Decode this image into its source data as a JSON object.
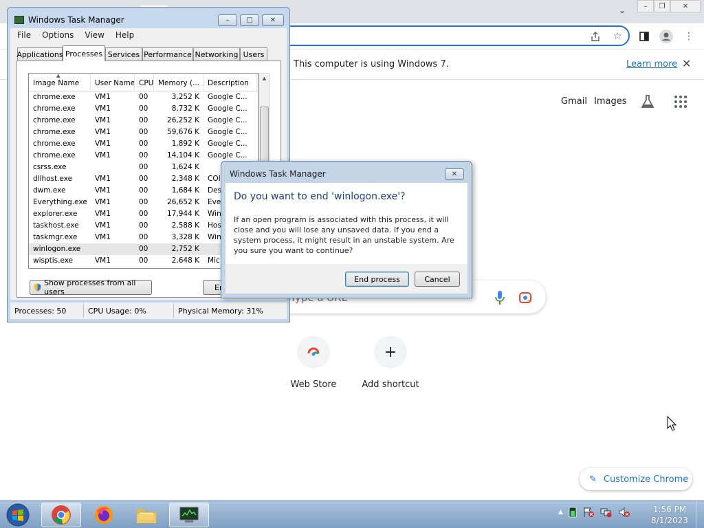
{
  "chrome": {
    "infobar_text": "This computer is using Windows 7.",
    "learn_more": "Learn more",
    "gmail": "Gmail",
    "images": "Images",
    "search_placeholder": "Type a URL",
    "shortcuts": [
      {
        "label": "Web Store",
        "icon": "chrome-web-store-icon"
      },
      {
        "label": "Add shortcut",
        "icon": "plus-icon",
        "glyph": "+"
      }
    ],
    "customize": "Customize Chrome"
  },
  "task_manager": {
    "title": "Windows Task Manager",
    "menu": [
      "File",
      "Options",
      "View",
      "Help"
    ],
    "tabs": [
      {
        "label": "Applications"
      },
      {
        "label": "Processes",
        "active": true
      },
      {
        "label": "Services"
      },
      {
        "label": "Performance"
      },
      {
        "label": "Networking"
      },
      {
        "label": "Users"
      }
    ],
    "columns": [
      "Image Name",
      "User Name",
      "CPU",
      "Memory (...",
      "Description"
    ],
    "processes": [
      {
        "name": "chrome.exe",
        "user": "VM1",
        "cpu": "00",
        "mem": "3,252 K",
        "desc": "Google C..."
      },
      {
        "name": "chrome.exe",
        "user": "VM1",
        "cpu": "00",
        "mem": "8,732 K",
        "desc": "Google C..."
      },
      {
        "name": "chrome.exe",
        "user": "VM1",
        "cpu": "00",
        "mem": "26,252 K",
        "desc": "Google C..."
      },
      {
        "name": "chrome.exe",
        "user": "VM1",
        "cpu": "00",
        "mem": "59,676 K",
        "desc": "Google C..."
      },
      {
        "name": "chrome.exe",
        "user": "VM1",
        "cpu": "00",
        "mem": "1,892 K",
        "desc": "Google C..."
      },
      {
        "name": "chrome.exe",
        "user": "VM1",
        "cpu": "00",
        "mem": "14,104 K",
        "desc": "Google C..."
      },
      {
        "name": "csrss.exe",
        "user": "",
        "cpu": "00",
        "mem": "1,624 K",
        "desc": ""
      },
      {
        "name": "dllhost.exe",
        "user": "VM1",
        "cpu": "00",
        "mem": "2,348 K",
        "desc": "COI"
      },
      {
        "name": "dwm.exe",
        "user": "VM1",
        "cpu": "00",
        "mem": "1,684 K",
        "desc": "Des"
      },
      {
        "name": "Everything.exe",
        "user": "VM1",
        "cpu": "00",
        "mem": "26,652 K",
        "desc": "Eve"
      },
      {
        "name": "explorer.exe",
        "user": "VM1",
        "cpu": "00",
        "mem": "17,944 K",
        "desc": "Win"
      },
      {
        "name": "taskhost.exe",
        "user": "VM1",
        "cpu": "00",
        "mem": "2,588 K",
        "desc": "Hos"
      },
      {
        "name": "taskmgr.exe",
        "user": "VM1",
        "cpu": "00",
        "mem": "3,328 K",
        "desc": "Win"
      },
      {
        "name": "winlogon.exe",
        "user": "",
        "cpu": "00",
        "mem": "2,752 K",
        "desc": "",
        "selected": true
      },
      {
        "name": "wisptis.exe",
        "user": "VM1",
        "cpu": "00",
        "mem": "2,648 K",
        "desc": "Mic"
      }
    ],
    "show_all_button": "Show processes from all users",
    "end_process_button": "End Process",
    "end_process_visible": "En",
    "status": {
      "processes": "Processes: 50",
      "cpu": "CPU Usage: 0%",
      "memory": "Physical Memory: 31%"
    }
  },
  "dialog": {
    "title": "Windows Task Manager",
    "heading": "Do you want to end 'winlogon.exe'?",
    "message": "If an open program is associated with this process, it will close and you will lose any unsaved data. If you end a system process, it might result in an unstable system. Are you sure you want to continue?",
    "confirm": "End process",
    "cancel": "Cancel"
  },
  "taskbar": {
    "pinned": [
      {
        "name": "chrome-icon",
        "active": true
      },
      {
        "name": "firefox-icon"
      },
      {
        "name": "file-explorer-icon"
      },
      {
        "name": "task-manager-icon",
        "active": true
      }
    ],
    "time": "1:56 PM",
    "date": "8/1/2023"
  },
  "colors": {
    "accent": "#1a73e8",
    "dialog_heading": "#1a3c8a",
    "window_frame": "#c5d8ed"
  }
}
